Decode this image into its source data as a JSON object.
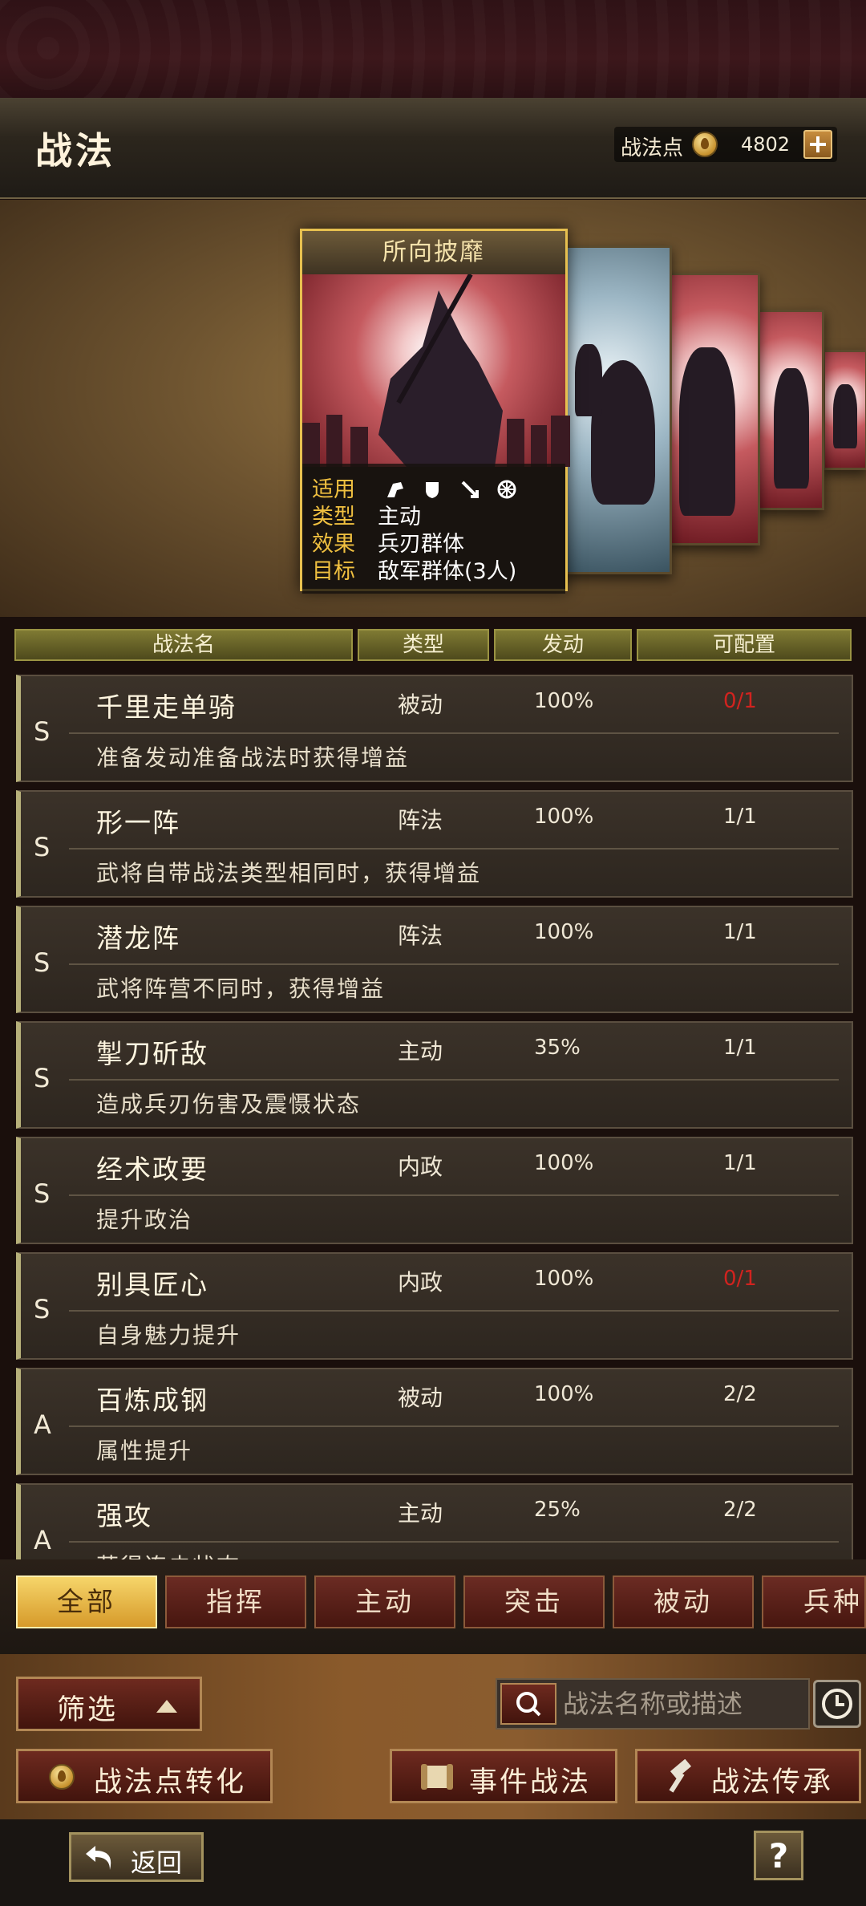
{
  "header": {
    "title": "战法",
    "points_label": "战法点",
    "points_value": "4802"
  },
  "featured": {
    "name": "所向披靡",
    "applicable_label": "适用",
    "applicable_units": [
      "cavalry-icon",
      "shield-icon",
      "archer-icon",
      "chariot-icon"
    ],
    "type_label": "类型",
    "type_value": "主动",
    "effect_label": "效果",
    "effect_value": "兵刃群体",
    "target_label": "目标",
    "target_value": "敌军群体(3人)"
  },
  "table": {
    "headers": [
      "战法名",
      "类型",
      "发动",
      "可配置"
    ],
    "rows": [
      {
        "grade": "S",
        "name": "千里走单骑",
        "type": "被动",
        "rate": "100%",
        "config": "0/1",
        "config_red": true,
        "desc": "准备发动准备战法时获得增益"
      },
      {
        "grade": "S",
        "name": "形一阵",
        "type": "阵法",
        "rate": "100%",
        "config": "1/1",
        "config_red": false,
        "desc": "武将自带战法类型相同时，获得增益"
      },
      {
        "grade": "S",
        "name": "潜龙阵",
        "type": "阵法",
        "rate": "100%",
        "config": "1/1",
        "config_red": false,
        "desc": "武将阵营不同时，获得增益"
      },
      {
        "grade": "S",
        "name": "掣刀斫敌",
        "type": "主动",
        "rate": "35%",
        "config": "1/1",
        "config_red": false,
        "desc": "造成兵刃伤害及震慑状态"
      },
      {
        "grade": "S",
        "name": "经术政要",
        "type": "内政",
        "rate": "100%",
        "config": "1/1",
        "config_red": false,
        "desc": "提升政治"
      },
      {
        "grade": "S",
        "name": "别具匠心",
        "type": "内政",
        "rate": "100%",
        "config": "0/1",
        "config_red": true,
        "desc": "自身魅力提升"
      },
      {
        "grade": "A",
        "name": "百炼成钢",
        "type": "被动",
        "rate": "100%",
        "config": "2/2",
        "config_red": false,
        "desc": "属性提升"
      },
      {
        "grade": "A",
        "name": "强攻",
        "type": "主动",
        "rate": "25%",
        "config": "2/2",
        "config_red": false,
        "desc": "获得连击状态"
      }
    ]
  },
  "tabs": [
    "全部",
    "指挥",
    "主动",
    "突击",
    "被动",
    "兵种"
  ],
  "active_tab": "全部",
  "controls": {
    "filter_label": "筛选",
    "search_placeholder": "战法名称或描述",
    "convert_label": "战法点转化",
    "event_label": "事件战法",
    "inherit_label": "战法传承",
    "back_label": "返回",
    "help_label": "?"
  },
  "colors": {
    "accent_gold": "#e7c04f",
    "config_red": "#d1231f",
    "tab_active": "#f6d56a"
  }
}
